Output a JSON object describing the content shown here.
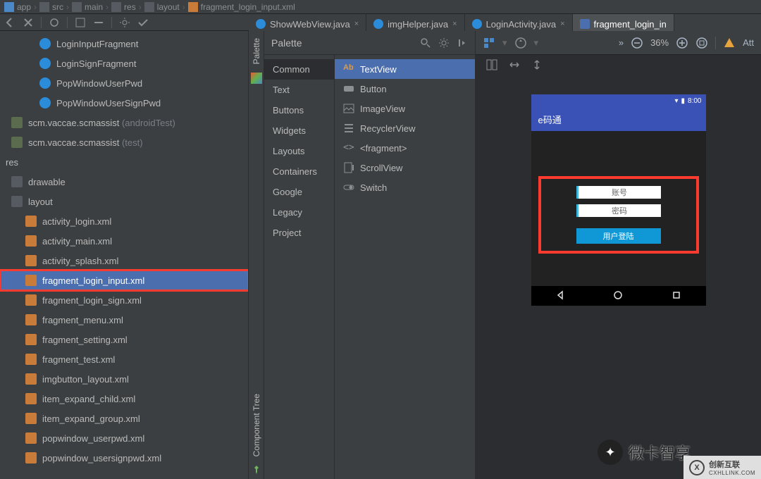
{
  "breadcrumb": [
    "app",
    "src",
    "main",
    "res",
    "layout",
    "fragment_login_input.xml"
  ],
  "tabs": [
    {
      "label": "ShowWebView.java",
      "type": "java",
      "active": false
    },
    {
      "label": "imgHelper.java",
      "type": "java",
      "active": false
    },
    {
      "label": "LoginActivity.java",
      "type": "java",
      "active": false
    },
    {
      "label": "fragment_login_in",
      "type": "xml",
      "active": true
    }
  ],
  "project": {
    "classes": [
      "LoginInputFragment",
      "LoginSignFragment",
      "PopWindowUserPwd",
      "PopWindowUserSignPwd"
    ],
    "packages": [
      {
        "name": "scm.vaccae.scmassist",
        "suffix": "(androidTest)"
      },
      {
        "name": "scm.vaccae.scmassist",
        "suffix": "(test)"
      }
    ],
    "res_label": "res",
    "folders": [
      "drawable",
      "layout"
    ],
    "layouts": [
      "activity_login.xml",
      "activity_main.xml",
      "activity_splash.xml",
      "fragment_login_input.xml",
      "fragment_login_sign.xml",
      "fragment_menu.xml",
      "fragment_setting.xml",
      "fragment_test.xml",
      "imgbutton_layout.xml",
      "item_expand_child.xml",
      "item_expand_group.xml",
      "popwindow_userpwd.xml",
      "popwindow_usersignpwd.xml"
    ],
    "selected": "fragment_login_input.xml"
  },
  "palette": {
    "title": "Palette",
    "tab_label": "Palette",
    "comp_tree_label": "Component Tree",
    "categories": [
      "Common",
      "Text",
      "Buttons",
      "Widgets",
      "Layouts",
      "Containers",
      "Google",
      "Legacy",
      "Project"
    ],
    "selected_category": "Common",
    "items": [
      {
        "label": "TextView",
        "icon": "Ab"
      },
      {
        "label": "Button",
        "icon": "rect"
      },
      {
        "label": "ImageView",
        "icon": "img"
      },
      {
        "label": "RecyclerView",
        "icon": "list"
      },
      {
        "label": "<fragment>",
        "icon": "frag"
      },
      {
        "label": "ScrollView",
        "icon": "scroll"
      },
      {
        "label": "Switch",
        "icon": "switch"
      }
    ],
    "selected_item": "TextView"
  },
  "design": {
    "zoom": "36%",
    "overflow": "»",
    "attr_label": "Att"
  },
  "phone": {
    "time": "8:00",
    "app_title": "e码通",
    "username_placeholder": "账号",
    "password_placeholder": "密码",
    "login_button": "用户登陆"
  },
  "watermark1": "微卡智享",
  "watermark2": {
    "brand": "创新互联",
    "sub": "CXHLLINK.COM"
  }
}
